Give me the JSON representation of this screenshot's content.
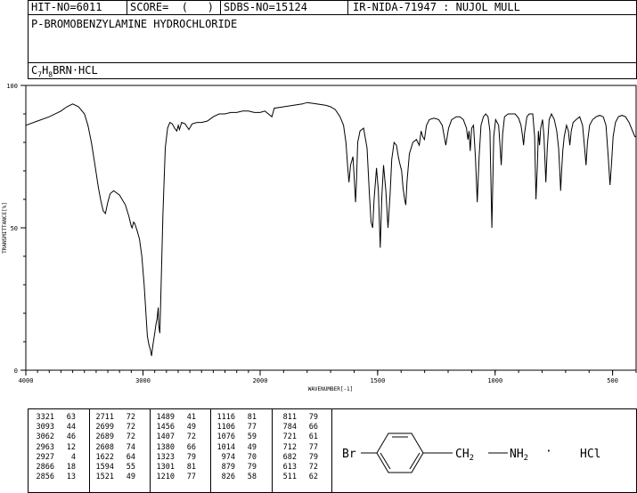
{
  "header": {
    "hit": "HIT-NO=6011",
    "score": "SCORE=  (   )",
    "sdbs": "SDBS-NO=15124",
    "ir": "IR-NIDA-71947 : NUJOL MULL"
  },
  "compound_name": "P-BROMOBENZYLAMINE HYDROCHLORIDE",
  "formula": {
    "C": "C",
    "c_sub": "7",
    "H": "H",
    "h_sub": "8",
    "rest": "BRN",
    "dot": "·",
    "hcl": "HCL"
  },
  "structure": {
    "br": "Br",
    "ch2": "CH",
    "ch2_sub": "2",
    "nh2": "NH",
    "nh2_sub": "2",
    "dot": "·",
    "hcl": "HCl"
  },
  "peak_table": {
    "columns": [
      [
        [
          "3321",
          "63"
        ],
        [
          "3093",
          "44"
        ],
        [
          "3062",
          "46"
        ],
        [
          "2963",
          "12"
        ],
        [
          "2927",
          "4"
        ],
        [
          "2866",
          "18"
        ],
        [
          "2856",
          "13"
        ]
      ],
      [
        [
          "2711",
          "72"
        ],
        [
          "2699",
          "72"
        ],
        [
          "2689",
          "72"
        ],
        [
          "2608",
          "74"
        ],
        [
          "1622",
          "64"
        ],
        [
          "1594",
          "55"
        ],
        [
          "1521",
          "49"
        ]
      ],
      [
        [
          "1489",
          "41"
        ],
        [
          "1456",
          "49"
        ],
        [
          "1407",
          "72"
        ],
        [
          "1380",
          "66"
        ],
        [
          "1323",
          "79"
        ],
        [
          "1301",
          "81"
        ],
        [
          "1210",
          "77"
        ]
      ],
      [
        [
          "1116",
          "81"
        ],
        [
          "1106",
          "77"
        ],
        [
          "1076",
          "59"
        ],
        [
          "1014",
          "49"
        ],
        [
          "974",
          "70"
        ],
        [
          "879",
          "79"
        ],
        [
          "826",
          "58"
        ]
      ],
      [
        [
          "811",
          "79"
        ],
        [
          "784",
          "66"
        ],
        [
          "721",
          "61"
        ],
        [
          "712",
          "77"
        ],
        [
          "682",
          "79"
        ],
        [
          "613",
          "72"
        ],
        [
          "511",
          "62"
        ]
      ]
    ]
  },
  "chart_data": {
    "type": "line",
    "xlabel": "WAVENUMBER[-1]",
    "ylabel": "TRANSMITTANCE[%]",
    "xlim": [
      4000,
      400
    ],
    "ylim": [
      0,
      100
    ],
    "x_ticks": [
      4000,
      3000,
      2000,
      1500,
      1000,
      500
    ],
    "y_ticks": [
      0,
      50,
      100
    ],
    "series": [
      {
        "points": [
          [
            4000,
            86
          ],
          [
            3900,
            87.5
          ],
          [
            3800,
            89
          ],
          [
            3700,
            91
          ],
          [
            3650,
            92.5
          ],
          [
            3600,
            93.5
          ],
          [
            3550,
            92.5
          ],
          [
            3500,
            90
          ],
          [
            3470,
            86
          ],
          [
            3440,
            80
          ],
          [
            3410,
            72
          ],
          [
            3380,
            64
          ],
          [
            3360,
            59.5
          ],
          [
            3340,
            56
          ],
          [
            3321,
            55
          ],
          [
            3300,
            59
          ],
          [
            3280,
            62
          ],
          [
            3250,
            63
          ],
          [
            3200,
            61.5
          ],
          [
            3150,
            58
          ],
          [
            3120,
            54
          ],
          [
            3100,
            50.5
          ],
          [
            3093,
            50
          ],
          [
            3080,
            52
          ],
          [
            3070,
            51.5
          ],
          [
            3062,
            50.5
          ],
          [
            3050,
            49
          ],
          [
            3030,
            46
          ],
          [
            3010,
            40
          ],
          [
            2990,
            30
          ],
          [
            2975,
            20
          ],
          [
            2963,
            12
          ],
          [
            2950,
            9
          ],
          [
            2935,
            7
          ],
          [
            2927,
            5
          ],
          [
            2915,
            9
          ],
          [
            2900,
            13
          ],
          [
            2890,
            16
          ],
          [
            2880,
            18
          ],
          [
            2870,
            22
          ],
          [
            2866,
            16
          ],
          [
            2860,
            14
          ],
          [
            2856,
            13
          ],
          [
            2850,
            22
          ],
          [
            2830,
            55
          ],
          [
            2810,
            78
          ],
          [
            2790,
            85
          ],
          [
            2770,
            87
          ],
          [
            2750,
            86.5
          ],
          [
            2730,
            85
          ],
          [
            2711,
            84
          ],
          [
            2699,
            86
          ],
          [
            2689,
            84.5
          ],
          [
            2670,
            87
          ],
          [
            2640,
            86.5
          ],
          [
            2608,
            84.5
          ],
          [
            2580,
            86.5
          ],
          [
            2540,
            87
          ],
          [
            2500,
            87
          ],
          [
            2450,
            87.5
          ],
          [
            2400,
            89
          ],
          [
            2350,
            90
          ],
          [
            2300,
            90
          ],
          [
            2250,
            90.5
          ],
          [
            2200,
            90.5
          ],
          [
            2150,
            91
          ],
          [
            2100,
            91
          ],
          [
            2050,
            90.5
          ],
          [
            2000,
            90.5
          ],
          [
            1980,
            91
          ],
          [
            1950,
            89
          ],
          [
            1940,
            92
          ],
          [
            1900,
            92.5
          ],
          [
            1860,
            93
          ],
          [
            1820,
            93.5
          ],
          [
            1800,
            94
          ],
          [
            1760,
            93.5
          ],
          [
            1720,
            93
          ],
          [
            1700,
            92.5
          ],
          [
            1680,
            91.5
          ],
          [
            1660,
            89
          ],
          [
            1645,
            86
          ],
          [
            1635,
            80
          ],
          [
            1628,
            72
          ],
          [
            1622,
            66
          ],
          [
            1615,
            72
          ],
          [
            1605,
            75
          ],
          [
            1600,
            68
          ],
          [
            1594,
            59
          ],
          [
            1590,
            66
          ],
          [
            1585,
            80
          ],
          [
            1575,
            84
          ],
          [
            1560,
            85
          ],
          [
            1545,
            78
          ],
          [
            1535,
            62
          ],
          [
            1528,
            52
          ],
          [
            1521,
            50
          ],
          [
            1515,
            60
          ],
          [
            1505,
            71
          ],
          [
            1497,
            63
          ],
          [
            1489,
            43
          ],
          [
            1482,
            61
          ],
          [
            1475,
            72
          ],
          [
            1465,
            63
          ],
          [
            1456,
            50
          ],
          [
            1447,
            62
          ],
          [
            1440,
            74
          ],
          [
            1430,
            80
          ],
          [
            1420,
            79
          ],
          [
            1412,
            75
          ],
          [
            1407,
            73
          ],
          [
            1398,
            70
          ],
          [
            1392,
            64
          ],
          [
            1385,
            60
          ],
          [
            1380,
            58
          ],
          [
            1375,
            66
          ],
          [
            1365,
            76
          ],
          [
            1350,
            80
          ],
          [
            1335,
            81
          ],
          [
            1323,
            79
          ],
          [
            1315,
            84
          ],
          [
            1308,
            82
          ],
          [
            1301,
            81
          ],
          [
            1292,
            86
          ],
          [
            1280,
            88
          ],
          [
            1260,
            88.5
          ],
          [
            1240,
            88
          ],
          [
            1225,
            86
          ],
          [
            1210,
            79
          ],
          [
            1198,
            85
          ],
          [
            1185,
            88
          ],
          [
            1165,
            89
          ],
          [
            1150,
            89
          ],
          [
            1135,
            88
          ],
          [
            1122,
            85
          ],
          [
            1116,
            81
          ],
          [
            1111,
            84
          ],
          [
            1106,
            77
          ],
          [
            1100,
            85
          ],
          [
            1092,
            86
          ],
          [
            1084,
            75
          ],
          [
            1076,
            59
          ],
          [
            1068,
            75
          ],
          [
            1060,
            86
          ],
          [
            1050,
            89
          ],
          [
            1040,
            90
          ],
          [
            1030,
            89
          ],
          [
            1022,
            84
          ],
          [
            1014,
            50
          ],
          [
            1006,
            82
          ],
          [
            998,
            88
          ],
          [
            985,
            86
          ],
          [
            980,
            80
          ],
          [
            974,
            72
          ],
          [
            968,
            83
          ],
          [
            960,
            89
          ],
          [
            945,
            90
          ],
          [
            930,
            90
          ],
          [
            915,
            90
          ],
          [
            900,
            88.5
          ],
          [
            890,
            86
          ],
          [
            883,
            82
          ],
          [
            879,
            79
          ],
          [
            875,
            83
          ],
          [
            865,
            89
          ],
          [
            855,
            90
          ],
          [
            840,
            90
          ],
          [
            832,
            82
          ],
          [
            826,
            60
          ],
          [
            820,
            72
          ],
          [
            816,
            84
          ],
          [
            811,
            79
          ],
          [
            806,
            85
          ],
          [
            798,
            88
          ],
          [
            792,
            82
          ],
          [
            784,
            66
          ],
          [
            778,
            78
          ],
          [
            770,
            88
          ],
          [
            760,
            90
          ],
          [
            748,
            88
          ],
          [
            738,
            84
          ],
          [
            730,
            78
          ],
          [
            725,
            70
          ],
          [
            721,
            63
          ],
          [
            717,
            70
          ],
          [
            712,
            77
          ],
          [
            706,
            82
          ],
          [
            696,
            86
          ],
          [
            688,
            84
          ],
          [
            682,
            79
          ],
          [
            676,
            84
          ],
          [
            668,
            87
          ],
          [
            655,
            88
          ],
          [
            640,
            89
          ],
          [
            628,
            86
          ],
          [
            619,
            78
          ],
          [
            613,
            72
          ],
          [
            607,
            80
          ],
          [
            598,
            86
          ],
          [
            585,
            88
          ],
          [
            570,
            89
          ],
          [
            555,
            89.5
          ],
          [
            540,
            89
          ],
          [
            528,
            86
          ],
          [
            518,
            74
          ],
          [
            511,
            65
          ],
          [
            505,
            72
          ],
          [
            498,
            82
          ],
          [
            488,
            87
          ],
          [
            475,
            89
          ],
          [
            460,
            89.5
          ],
          [
            445,
            89
          ],
          [
            430,
            87
          ],
          [
            415,
            84
          ],
          [
            405,
            82
          ],
          [
            400,
            82
          ]
        ]
      }
    ]
  }
}
